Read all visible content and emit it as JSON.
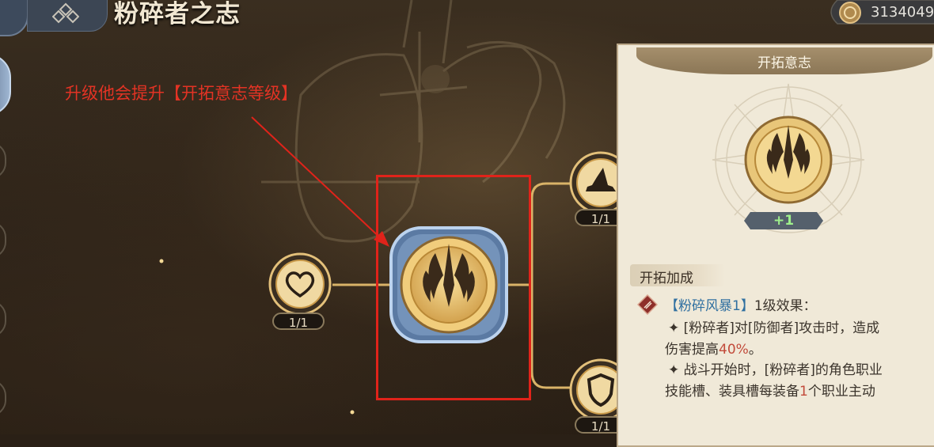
{
  "header": {
    "title": "粉碎者之志"
  },
  "currency": {
    "amount": "3134049"
  },
  "annotation": {
    "text": "升级他会提升【开拓意志等级】"
  },
  "tree": {
    "left_node": {
      "icon": "heart-icon",
      "count": "1/1"
    },
    "center_node": {
      "icon": "crushing-will-emblem-icon"
    },
    "top_right_node": {
      "icon": "hat-icon",
      "count": "1/1"
    },
    "bottom_right_node": {
      "icon": "shield-icon",
      "count": "1/1"
    }
  },
  "panel": {
    "title": "开拓意志",
    "emblem_icon": "crushing-will-emblem-icon",
    "level_badge": "+1",
    "section_title": "开拓加成",
    "effect": {
      "name": "【粉碎风暴1】",
      "level_label": "1级效果：",
      "line1_star": "✦",
      "line1_a": "[粉碎者]对[防御者]攻击时，造成",
      "line2_a": "伤害提高",
      "line2_hi": "40%",
      "line2_b": "。",
      "line3_star": "✦",
      "line3_a": "战斗开始时，[粉碎者]的角色职业",
      "line4_a": "技能槽、装具槽每装备",
      "line4_hi": "1",
      "line4_b": "个职业主动"
    }
  },
  "colors": {
    "annotation_red": "#e33324",
    "effect_name_blue": "#2f6fa0",
    "highlight_red": "#c24a3a",
    "level_green": "#9ff08c",
    "gold": "#e2bf6e"
  }
}
